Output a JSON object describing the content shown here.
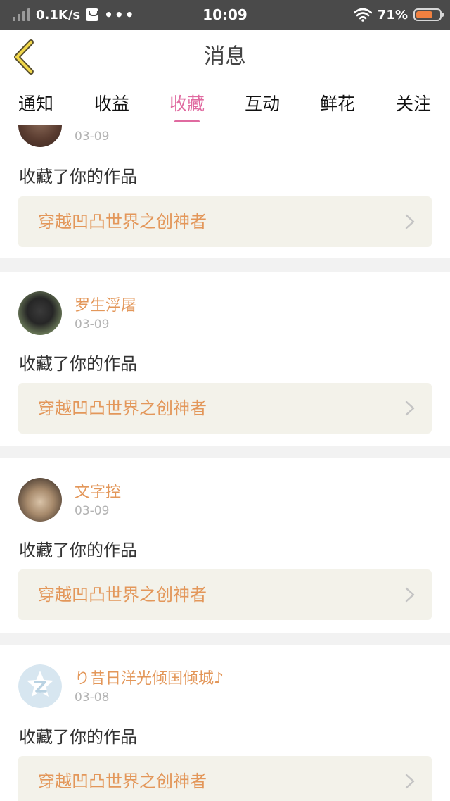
{
  "status_bar": {
    "network_speed": "0.1K/s",
    "dots": "•••",
    "time": "10:09",
    "battery_percent": "71%",
    "battery_level": 0.71,
    "battery_color": "#f08040"
  },
  "header": {
    "back_icon": "chevron-left-icon",
    "title": "消息"
  },
  "tabs": [
    {
      "label": "通知",
      "active": false
    },
    {
      "label": "收益",
      "active": false
    },
    {
      "label": "收藏",
      "active": true
    },
    {
      "label": "互动",
      "active": false
    },
    {
      "label": "鲜花",
      "active": false
    },
    {
      "label": "关注",
      "active": false
    }
  ],
  "feed": [
    {
      "username": "",
      "date": "03-09",
      "action": "收藏了你的作品",
      "work": "穿越凹凸世界之创神者"
    },
    {
      "username": "罗生浮屠",
      "date": "03-09",
      "action": "收藏了你的作品",
      "work": "穿越凹凸世界之创神者"
    },
    {
      "username": "文字控",
      "date": "03-09",
      "action": "收藏了你的作品",
      "work": "穿越凹凸世界之创神者"
    },
    {
      "username": "り昔日洋光倾国倾城♪",
      "date": "03-08",
      "action": "收藏了你的作品",
      "work": "穿越凹凸世界之创神者"
    }
  ],
  "colors": {
    "accent_pink": "#e06aa0",
    "name_orange": "#e3975a",
    "status_bar_bg": "#4a4a4a"
  }
}
